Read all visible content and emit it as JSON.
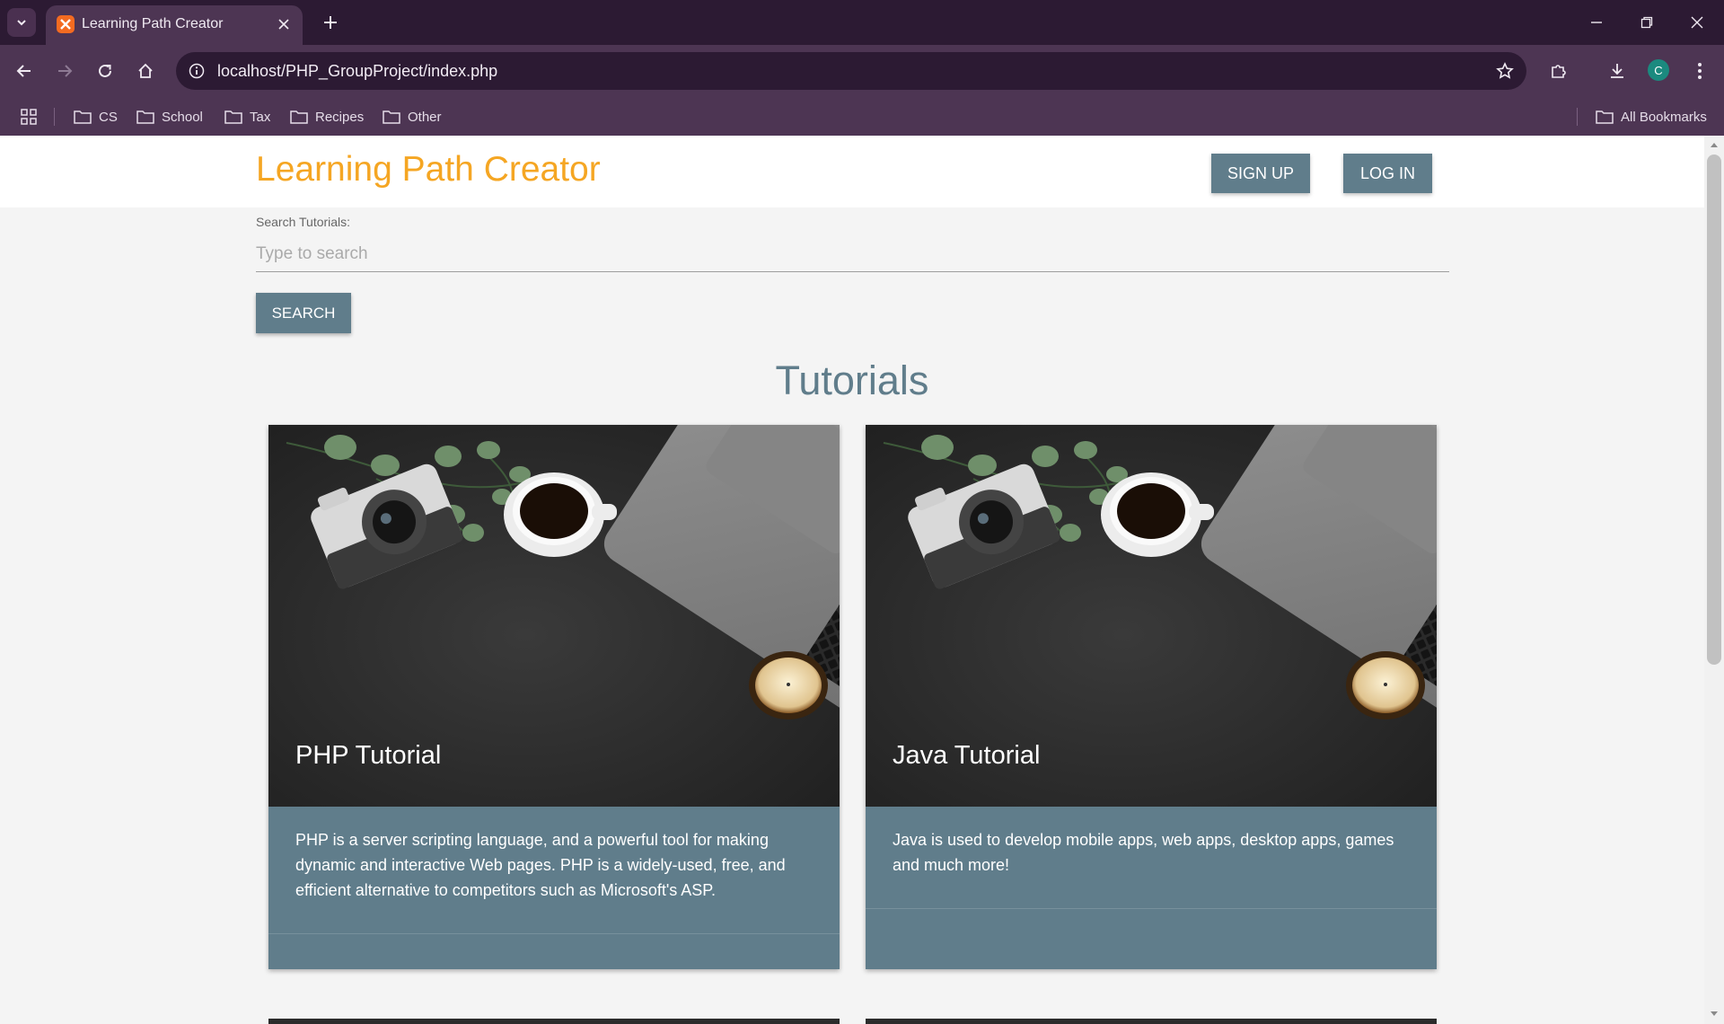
{
  "browser": {
    "tab_title": "Learning Path Creator",
    "url": "localhost/PHP_GroupProject/index.php",
    "profile_initial": "C",
    "bookmarks": [
      "CS",
      "School",
      "Tax",
      "Recipes",
      "Other"
    ],
    "all_bookmarks_label": "All Bookmarks"
  },
  "header": {
    "title": "Learning Path Creator",
    "signup_label": "SIGN UP",
    "login_label": "LOG IN"
  },
  "search": {
    "label": "Search Tutorials:",
    "placeholder": "Type to search",
    "button_label": "SEARCH"
  },
  "section_title": "Tutorials",
  "tutorials": [
    {
      "title": "PHP Tutorial",
      "description": "PHP is a server scripting language, and a powerful tool for making dynamic and interactive Web pages. PHP is a widely-used, free, and efficient alternative to competitors such as Microsoft's ASP."
    },
    {
      "title": "Java Tutorial",
      "description": "Java is used to develop mobile apps, web apps, desktop apps, games and much more!"
    }
  ],
  "colors": {
    "accent": "#f5a623",
    "primary": "#607d8b",
    "browser_frame": "#4d3553"
  }
}
